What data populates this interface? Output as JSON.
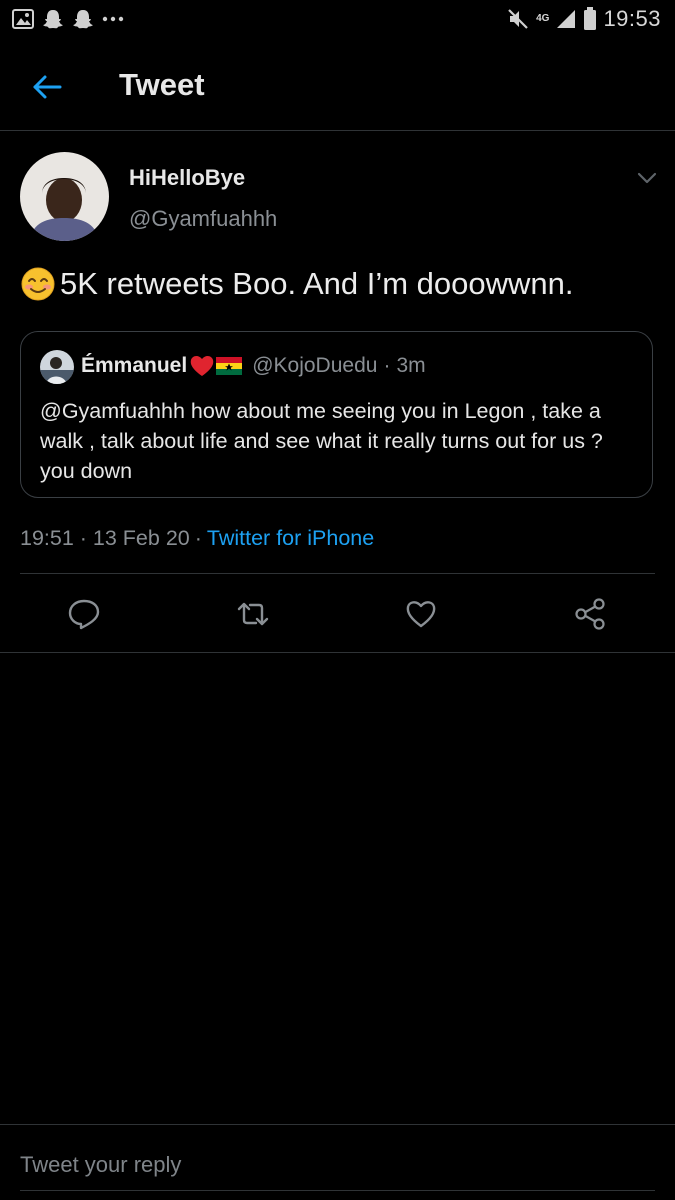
{
  "status_bar": {
    "time": "19:53",
    "network": "4G",
    "icons": [
      "gallery-icon",
      "snapchat-icon",
      "snapchat-icon",
      "more-dots-icon",
      "mute-icon",
      "signal-icon",
      "battery-icon"
    ]
  },
  "header": {
    "title": "Tweet",
    "back_icon": "back-arrow-icon"
  },
  "tweet": {
    "author": {
      "display_name": "HiHelloBye",
      "handle": "@Gyamfuahhh"
    },
    "emoji": "smiling-face-emoji",
    "text": "5K retweets Boo. And I’m dooowwnn.",
    "timestamp": "19:51 · 13 Feb 20",
    "separator": "·",
    "source": "Twitter for iPhone"
  },
  "quoted_tweet": {
    "display_name": "Émmanuel",
    "name_emojis": [
      "red-heart-emoji",
      "ghana-flag-emoji"
    ],
    "handle": "@KojoDuedu",
    "separator": "·",
    "time_ago": "3m",
    "text": "@Gyamfuahhh how about me seeing you in Legon , take a walk , talk about life and see what it really turns out for us ? you down"
  },
  "actions": [
    {
      "name": "reply",
      "icon": "reply-icon"
    },
    {
      "name": "retweet",
      "icon": "retweet-icon"
    },
    {
      "name": "like",
      "icon": "heart-icon"
    },
    {
      "name": "share",
      "icon": "share-icon"
    }
  ],
  "reply_box": {
    "placeholder": "Tweet your reply",
    "value": ""
  },
  "colors": {
    "background": "#000000",
    "accent": "#1da1f2",
    "secondary_text": "#8a8f94",
    "divider": "#2f3336"
  }
}
